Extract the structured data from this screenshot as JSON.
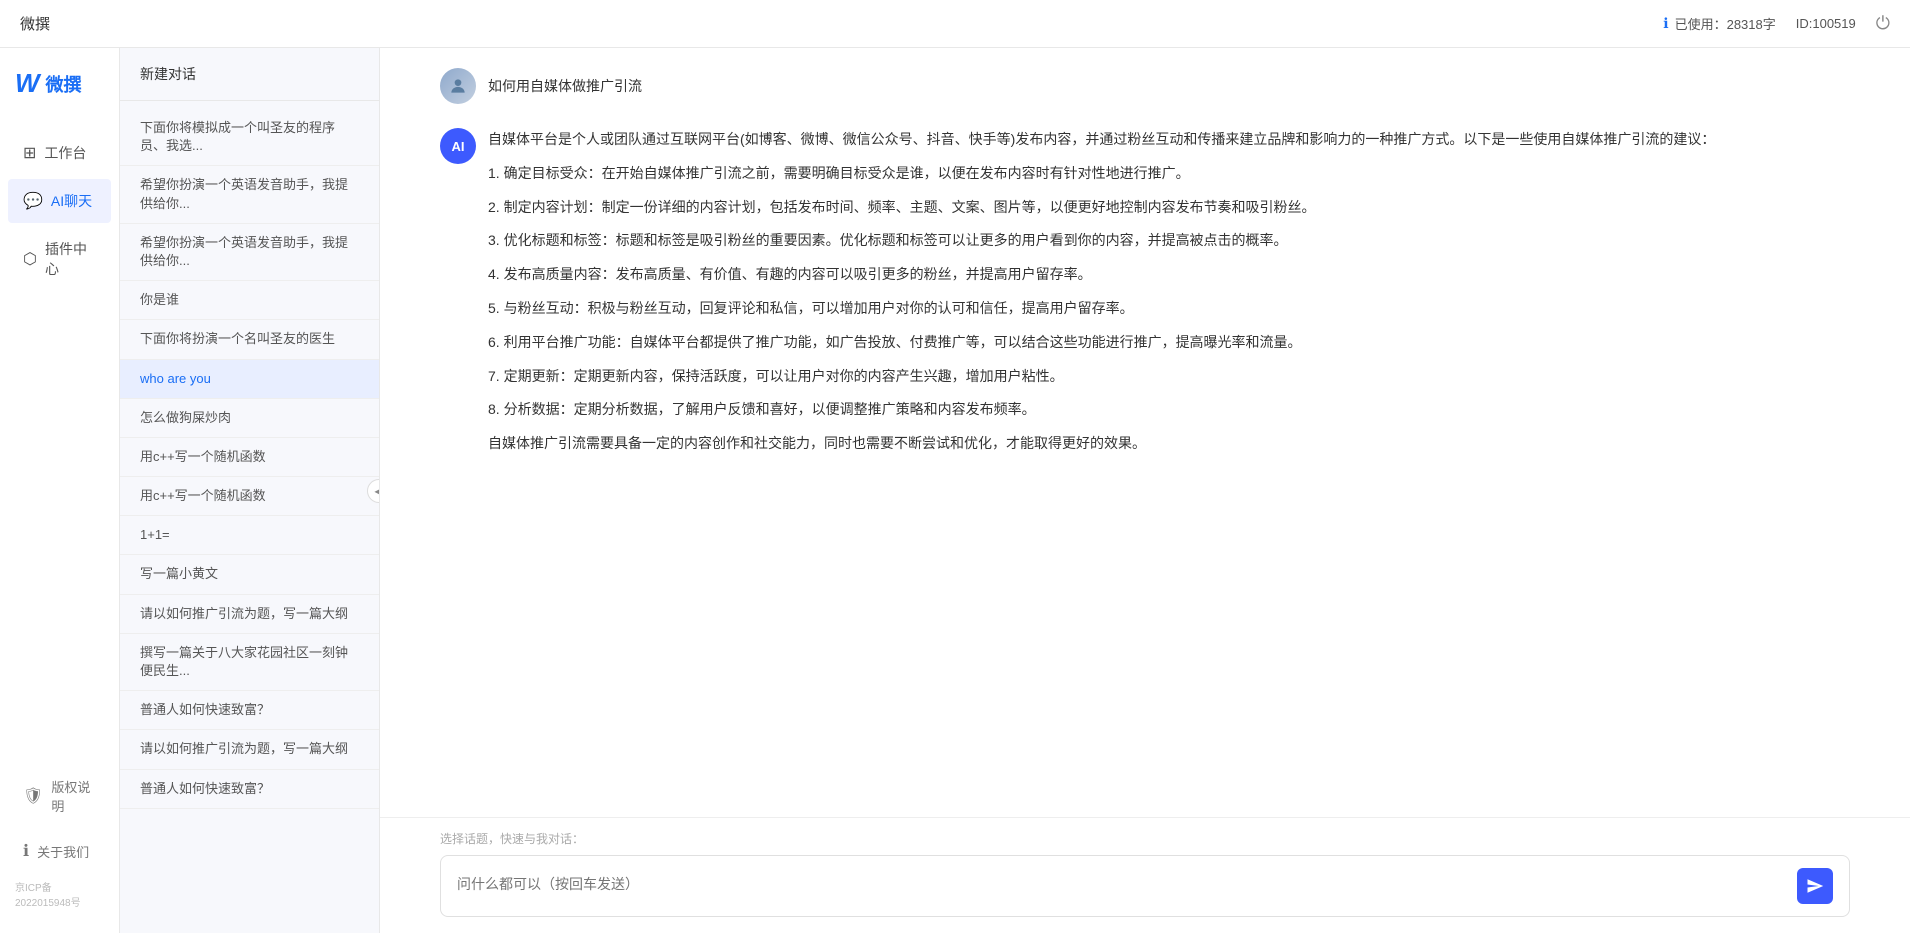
{
  "topbar": {
    "title": "微撰",
    "usage_label": "已使用：28318字",
    "id_label": "ID:100519",
    "usage_icon": "info-icon",
    "power_icon": "power-icon"
  },
  "nav": {
    "logo_w": "W",
    "logo_text": "微撰",
    "items": [
      {
        "id": "workbench",
        "label": "工作台",
        "icon": "grid-icon"
      },
      {
        "id": "ai-chat",
        "label": "AI聊天",
        "icon": "chat-icon",
        "active": true
      },
      {
        "id": "plugin-center",
        "label": "插件中心",
        "icon": "plugin-icon"
      }
    ],
    "bottom_items": [
      {
        "id": "copyright",
        "label": "版权说明",
        "icon": "shield-icon"
      },
      {
        "id": "about",
        "label": "关于我们",
        "icon": "info-circle-icon"
      }
    ],
    "icp": "京ICP备2022015948号"
  },
  "chat_sidebar": {
    "new_chat_label": "新建对话",
    "history": [
      {
        "id": 1,
        "text": "下面你将模拟成一个叫圣友的程序员、我选...",
        "active": false
      },
      {
        "id": 2,
        "text": "希望你扮演一个英语发音助手，我提供给你...",
        "active": false
      },
      {
        "id": 3,
        "text": "希望你扮演一个英语发音助手，我提供给你...",
        "active": false
      },
      {
        "id": 4,
        "text": "你是谁",
        "active": false
      },
      {
        "id": 5,
        "text": "下面你将扮演一个名叫圣友的医生",
        "active": false
      },
      {
        "id": 6,
        "text": "who are you",
        "active": true
      },
      {
        "id": 7,
        "text": "怎么做狗屎炒肉",
        "active": false
      },
      {
        "id": 8,
        "text": "用c++写一个随机函数",
        "active": false
      },
      {
        "id": 9,
        "text": "用c++写一个随机函数",
        "active": false
      },
      {
        "id": 10,
        "text": "1+1=",
        "active": false
      },
      {
        "id": 11,
        "text": "写一篇小黄文",
        "active": false
      },
      {
        "id": 12,
        "text": "请以如何推广引流为题，写一篇大纲",
        "active": false
      },
      {
        "id": 13,
        "text": "撰写一篇关于八大家花园社区一刻钟便民生...",
        "active": false
      },
      {
        "id": 14,
        "text": "普通人如何快速致富？",
        "active": false
      },
      {
        "id": 15,
        "text": "请以如何推广引流为题，写一篇大纲",
        "active": false
      },
      {
        "id": 16,
        "text": "普通人如何快速致富？",
        "active": false
      }
    ]
  },
  "chat": {
    "user_question": "如何用自媒体做推广引流",
    "ai_response_intro": "自媒体平台是个人或团队通过互联网平台(如博客、微博、微信公众号、抖音、快手等)发布内容，并通过粉丝互动和传播来建立品牌和影响力的一种推广方式。以下是一些使用自媒体推广引流的建议：",
    "ai_response_points": [
      "1. 确定目标受众：在开始自媒体推广引流之前，需要明确目标受众是谁，以便在发布内容时有针对性地进行推广。",
      "2. 制定内容计划：制定一份详细的内容计划，包括发布时间、频率、主题、文案、图片等，以便更好地控制内容发布节奏和吸引粉丝。",
      "3. 优化标题和标签：标题和标签是吸引粉丝的重要因素。优化标题和标签可以让更多的用户看到你的内容，并提高被点击的概率。",
      "4. 发布高质量内容：发布高质量、有价值、有趣的内容可以吸引更多的粉丝，并提高用户留存率。",
      "5. 与粉丝互动：积极与粉丝互动，回复评论和私信，可以增加用户对你的认可和信任，提高用户留存率。",
      "6. 利用平台推广功能：自媒体平台都提供了推广功能，如广告投放、付费推广等，可以结合这些功能进行推广，提高曝光率和流量。",
      "7. 定期更新：定期更新内容，保持活跃度，可以让用户对你的内容产生兴趣，增加用户粘性。",
      "8. 分析数据：定期分析数据，了解用户反馈和喜好，以便调整推广策略和内容发布频率。"
    ],
    "ai_response_conclusion": "自媒体推广引流需要具备一定的内容创作和社交能力，同时也需要不断尝试和优化，才能取得更好的效果。",
    "quick_topic_label": "选择话题，快速与我对话：",
    "input_placeholder": "问什么都可以（按回车发送）"
  }
}
